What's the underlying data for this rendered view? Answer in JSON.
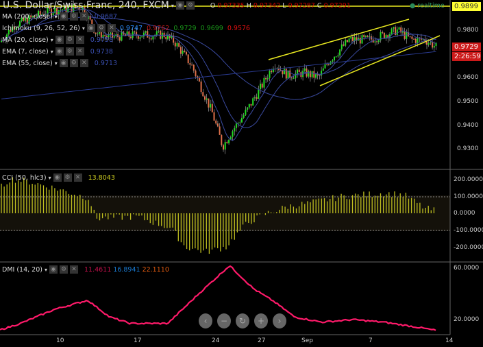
{
  "header": {
    "title": "U.S. Dollar/Swiss Franc, 240, FXCM",
    "o_label": "O",
    "o": "0.97335",
    "h_label": "H",
    "h": "0.97342",
    "l_label": "L",
    "l": "0.97287",
    "c_label": "C",
    "c": "0.97291",
    "realtime": "realtime"
  },
  "indicators": [
    {
      "name": "MA (200, close)",
      "value": "0.9687",
      "color": "#3a4fb0"
    },
    {
      "name": "Ichimoku (9, 26, 52, 26)",
      "values": [
        {
          "v": "0.9747",
          "c": "#2a8cff"
        },
        {
          "v": "0.9762",
          "c": "#c01818"
        },
        {
          "v": "0.9729",
          "c": "#1a9a1a"
        },
        {
          "v": "0.9699",
          "c": "#1a9a1a"
        },
        {
          "v": "0.9576",
          "c": "#e01010"
        }
      ]
    },
    {
      "name": "MA (20, close)",
      "value": "0.9758",
      "color": "#3a4fb0"
    },
    {
      "name": "EMA (7, close)",
      "value": "0.9738",
      "color": "#3a4fb0"
    },
    {
      "name": "EMA (55, close)",
      "value": "0.9713",
      "color": "#3a4fb0"
    }
  ],
  "cci": {
    "name": "CCI (50, hlc3)",
    "value": "13.8043",
    "ticks": [
      "200.0000",
      "100.0000",
      "0.0000",
      "-100.0000",
      "-200.0000"
    ]
  },
  "dmi": {
    "name": "DMI (14, 20)",
    "v1": "11.4611",
    "v2": "16.8941",
    "v3": "22.1110",
    "ticks": [
      "60.0000",
      "20.0000"
    ]
  },
  "price_axis": {
    "ticks": [
      "0.9800",
      "0.9600",
      "0.9500",
      "0.9400",
      "0.9300"
    ],
    "hline": "0.9899",
    "last": "0.9729",
    "countdown": "2:26:59"
  },
  "time_axis": [
    "10",
    "17",
    "24",
    "27",
    "Sep",
    "7",
    "14"
  ],
  "nav": {
    "prev": "‹",
    "zoom_out": "−",
    "reset": "↻",
    "zoom_in": "+",
    "next": "›"
  },
  "price_path": [
    [
      0,
      0.975
    ],
    [
      20,
      0.982
    ],
    [
      70,
      0.988
    ],
    [
      120,
      0.99
    ],
    [
      140,
      0.979
    ],
    [
      160,
      0.977
    ],
    [
      200,
      0.978
    ],
    [
      240,
      0.978
    ],
    [
      255,
      0.975
    ],
    [
      280,
      0.965
    ],
    [
      310,
      0.945
    ],
    [
      325,
      0.931
    ],
    [
      340,
      0.938
    ],
    [
      360,
      0.946
    ],
    [
      385,
      0.958
    ],
    [
      400,
      0.966
    ],
    [
      420,
      0.961
    ],
    [
      445,
      0.962
    ],
    [
      465,
      0.96
    ],
    [
      480,
      0.967
    ],
    [
      510,
      0.976
    ],
    [
      540,
      0.976
    ],
    [
      580,
      0.98
    ],
    [
      600,
      0.976
    ],
    [
      620,
      0.976
    ],
    [
      637,
      0.9729
    ]
  ],
  "cci_path": [
    [
      0,
      150
    ],
    [
      15,
      205
    ],
    [
      40,
      190
    ],
    [
      80,
      150
    ],
    [
      130,
      90
    ],
    [
      140,
      -30
    ],
    [
      200,
      -20
    ],
    [
      250,
      -90
    ],
    [
      270,
      -200
    ],
    [
      300,
      -230
    ],
    [
      330,
      -200
    ],
    [
      360,
      -60
    ],
    [
      390,
      0
    ],
    [
      420,
      40
    ],
    [
      450,
      60
    ],
    [
      500,
      100
    ],
    [
      560,
      120
    ],
    [
      590,
      110
    ],
    [
      620,
      30
    ],
    [
      637,
      14
    ]
  ],
  "dmi_path": [
    [
      0,
      12
    ],
    [
      30,
      17
    ],
    [
      80,
      28
    ],
    [
      128,
      35
    ],
    [
      160,
      22
    ],
    [
      190,
      17
    ],
    [
      245,
      17
    ],
    [
      290,
      40
    ],
    [
      335,
      62
    ],
    [
      370,
      44
    ],
    [
      400,
      34
    ],
    [
      430,
      22
    ],
    [
      470,
      18
    ],
    [
      515,
      20
    ],
    [
      560,
      18
    ],
    [
      610,
      14
    ],
    [
      637,
      11.5
    ]
  ]
}
